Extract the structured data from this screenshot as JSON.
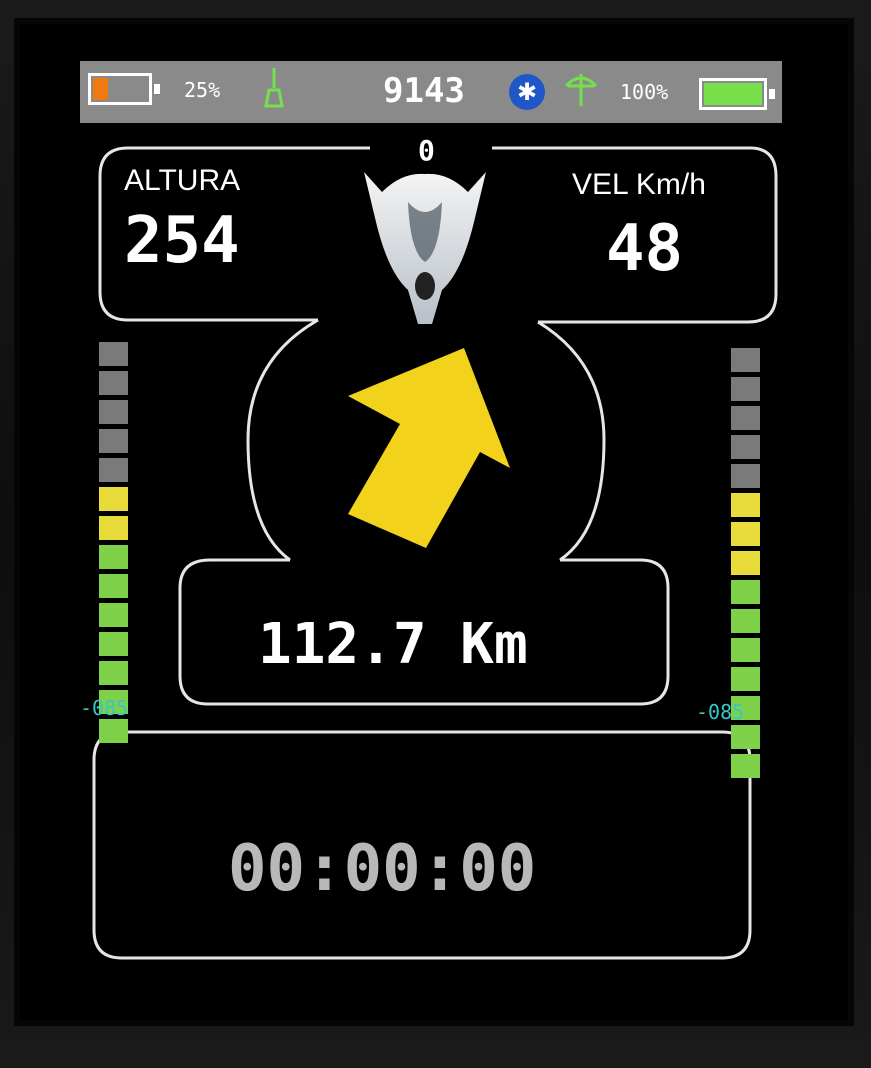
{
  "status_bar": {
    "battery_left_percent": "25%",
    "battery_left_level": 0.25,
    "center_value": "9143",
    "battery_right_percent": "100%",
    "battery_right_level": 1.0,
    "icons": [
      "battery-icon",
      "gps-antenna-icon",
      "bluetooth-icon",
      "signal-antenna-icon",
      "battery-icon"
    ]
  },
  "heading_value": "0",
  "altitude": {
    "label": "ALTURA",
    "value": "254"
  },
  "speed": {
    "label": "VEL Km/h",
    "value": "48"
  },
  "distance": "112.7 Km",
  "timer": "00:00:00",
  "vario_left": {
    "label": "-085",
    "segments": [
      "gray",
      "gray",
      "gray",
      "gray",
      "gray",
      "yellow",
      "yellow",
      "green",
      "green",
      "green",
      "green",
      "green",
      "green",
      "green"
    ]
  },
  "vario_right": {
    "label": "-085",
    "segments": [
      "gray",
      "gray",
      "gray",
      "gray",
      "gray",
      "yellow",
      "yellow",
      "yellow",
      "green",
      "green",
      "green",
      "green",
      "green",
      "green",
      "green"
    ]
  },
  "colors": {
    "gray": "#7a7a7a",
    "yellow": "#e8dc3a",
    "green": "#7fd14a",
    "arrow": "#f2d21a",
    "battery_low": "#f07a10",
    "battery_full": "#78e04a",
    "vario_label": "#36c7c7"
  }
}
